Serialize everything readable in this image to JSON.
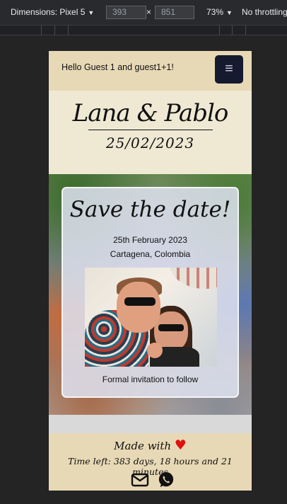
{
  "devtools": {
    "dimensions_label": "Dimensions: Pixel 5",
    "width": "393",
    "times": "×",
    "height": "851",
    "zoom": "73%",
    "throttling": "No throttling"
  },
  "nav": {
    "greeting": "Hello Guest 1 and guest1+1!",
    "menu_icon": "hamburger-menu-icon",
    "menu_glyph": "≡"
  },
  "header": {
    "couple": "Lana & Pablo",
    "date": "25/02/2023"
  },
  "card": {
    "title": "Save the date!",
    "date_long": "25th February 2023",
    "location": "Cartagena, Colombia",
    "photo_icon": "couple-photo",
    "follow_text": "Formal invitation to follow"
  },
  "footer": {
    "made_with": "Made with",
    "heart": "♥",
    "time_left": "Time left: 383 days, 18 hours and 21 minutes",
    "icons": [
      "envelope-icon",
      "whatsapp-icon"
    ]
  },
  "colors": {
    "beige": "#e8d9b6",
    "cream": "#efe9d4",
    "navy": "#151a2e",
    "heart": "#e01010"
  }
}
